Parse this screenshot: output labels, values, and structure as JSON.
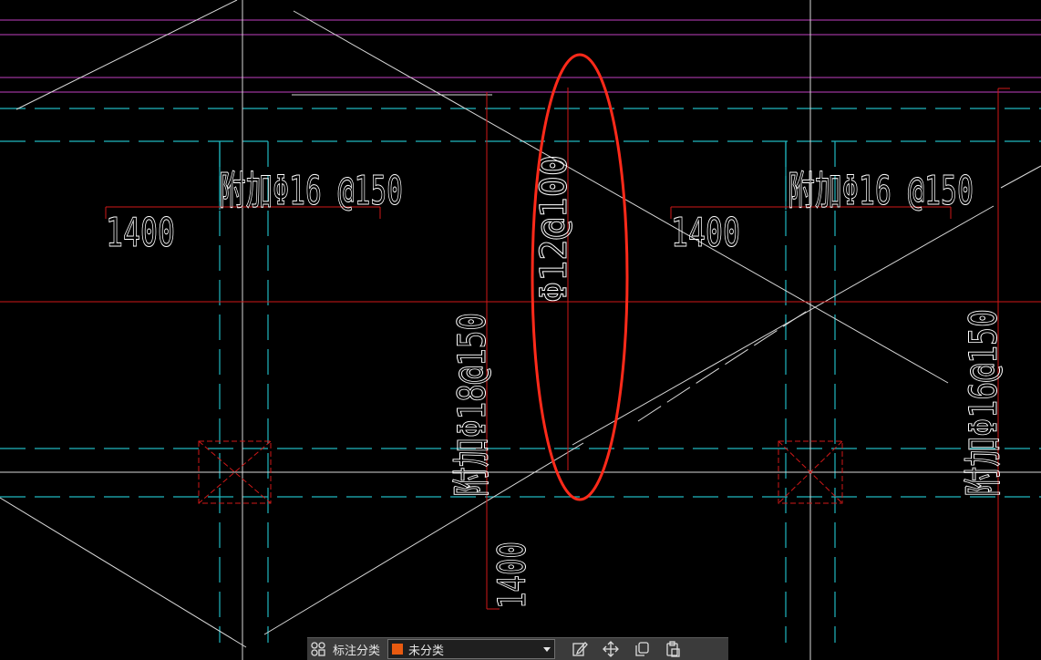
{
  "drawing": {
    "annotations": {
      "top_left_rebar": "附加Φ16 @150",
      "top_left_length": "1400",
      "top_right_rebar": "附加Φ16 @150",
      "top_right_length": "1400",
      "vertical_center": "Φ12@100",
      "vertical_left": "附加Φ18@150",
      "vertical_bottom_length": "1400",
      "vertical_right": "附加Φ16@150"
    },
    "colors": {
      "background": "#000000",
      "magenta_line": "#c040c0",
      "cyan_dash": "#20b8c0",
      "red_line": "#d01818",
      "white_line": "#d8d8d8",
      "highlight_ellipse": "#ff2a1a"
    }
  },
  "toolbar": {
    "label": "标注分类",
    "select_value": "未分类",
    "select_swatch_color": "#e85a10",
    "icons": [
      "annotation-category-icon",
      "edit-icon",
      "move-icon",
      "copy-icon",
      "paste-icon"
    ]
  }
}
